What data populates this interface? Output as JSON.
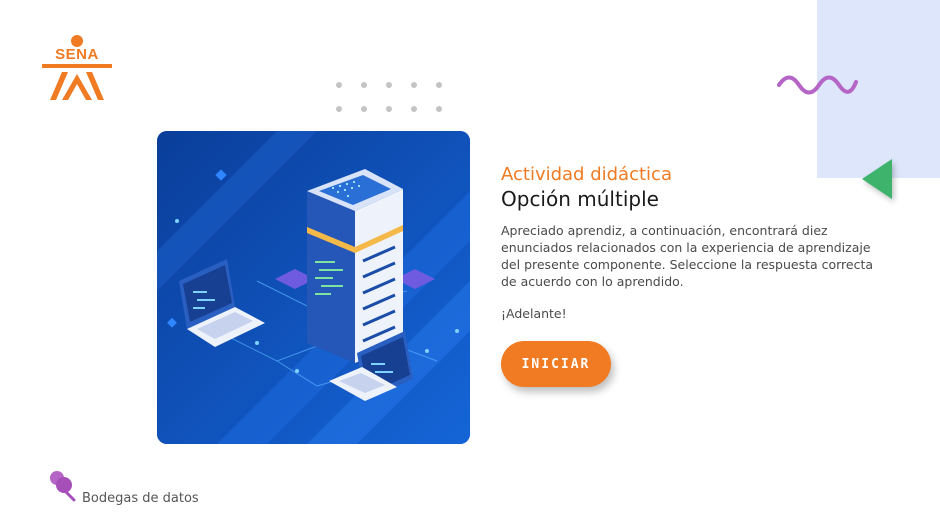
{
  "brand": {
    "logo_text": "SENA",
    "color": "#f07b23"
  },
  "activity": {
    "kicker": "Actividad didáctica",
    "title": "Opción múltiple",
    "description": "Apreciado aprendiz, a continuación, encontrará diez enunciados relacionados con la experiencia de aprendizaje del presente componente. Seleccione la respuesta correcta de acuerdo con lo aprendido.",
    "cheer": "¡Adelante!",
    "start_label": "INICIAR"
  },
  "footer": {
    "course_name": "Bodegas de datos"
  },
  "colors": {
    "accent_orange": "#f07b23",
    "panel_blue": "#dde6fb",
    "wave_purple": "#b565c6",
    "triangle_green": "#3db36b",
    "hero_blue": "#0d47a8"
  },
  "icons": {
    "hero": "server-network-illustration",
    "footer": "push-pin-icon",
    "logo": "sena-logo"
  }
}
